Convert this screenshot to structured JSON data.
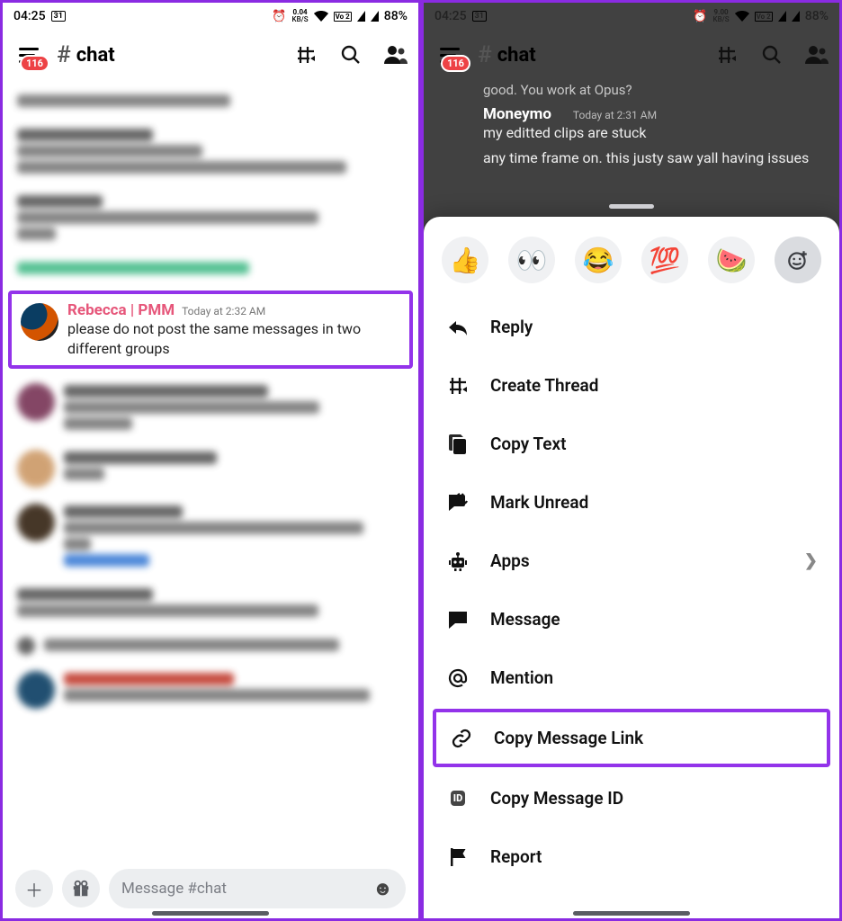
{
  "status": {
    "time": "04:25",
    "date_icon": "31",
    "kbs_left": "0.04",
    "kbs_left_unit": "KB/S",
    "kbs_right": "9.00",
    "kbs_right_unit": "KB/S",
    "lte": "LTE 2",
    "volte": "Vo 2",
    "battery": "88%"
  },
  "header": {
    "unread_badge": "116",
    "channel_name": "chat",
    "composer_placeholder": "Message #chat"
  },
  "highlighted_msg": {
    "author": "Rebecca | PMM",
    "timestamp": "Today at 2:32 AM",
    "body": "please do not post the same messages in two different groups"
  },
  "right_context": {
    "reply_context": "good. You work at Opus?",
    "author": "Moneymo",
    "timestamp": "Today at 2:31 AM",
    "line1": "my editted clips are stuck",
    "line2": "any time frame on. this justy saw yall having issues"
  },
  "reactions": [
    "👍",
    "👀",
    "😂",
    "💯",
    "🍉"
  ],
  "menu": [
    {
      "key": "reply",
      "label": "Reply",
      "icon": "reply"
    },
    {
      "key": "create_thread",
      "label": "Create Thread",
      "icon": "thread"
    },
    {
      "key": "copy_text",
      "label": "Copy Text",
      "icon": "copy"
    },
    {
      "key": "mark_unread",
      "label": "Mark Unread",
      "icon": "unread"
    },
    {
      "key": "apps",
      "label": "Apps",
      "icon": "robot",
      "chevron": true
    },
    {
      "key": "message",
      "label": "Message",
      "icon": "message"
    },
    {
      "key": "mention",
      "label": "Mention",
      "icon": "mention"
    },
    {
      "key": "copy_link",
      "label": "Copy Message Link",
      "icon": "link",
      "highlight": true
    },
    {
      "key": "copy_id",
      "label": "Copy Message ID",
      "icon": "id"
    },
    {
      "key": "report",
      "label": "Report",
      "icon": "flag"
    }
  ]
}
